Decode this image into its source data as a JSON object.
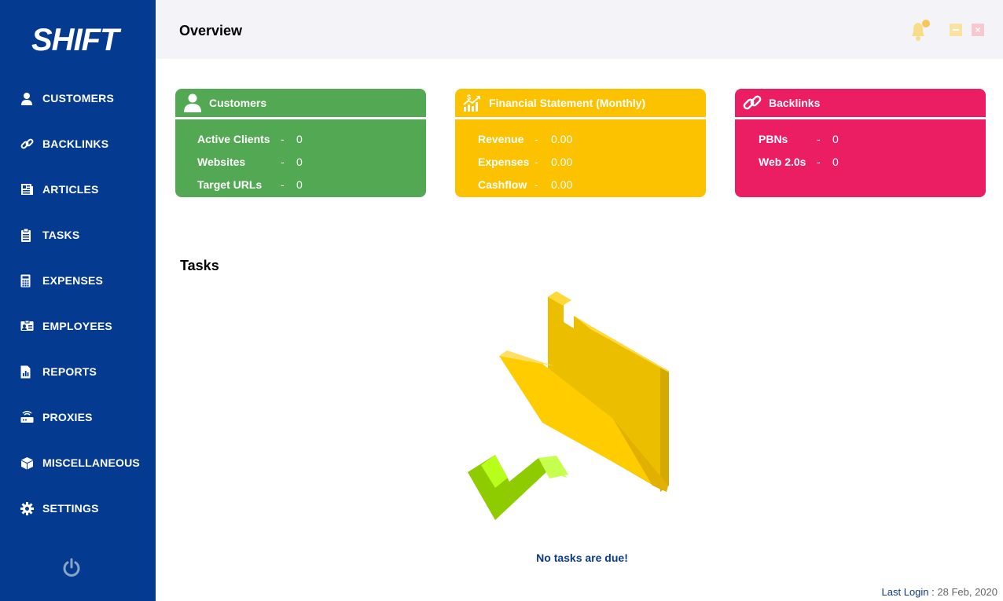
{
  "app": {
    "logo_text": "SHIFT",
    "colors": {
      "sidebar": "#043a8f",
      "header": "#f4f4f8",
      "green": "#53a953",
      "yellow": "#fcc200",
      "pink": "#eb1e63",
      "accent_text": "#0a3a8a"
    }
  },
  "sidebar": {
    "items": [
      {
        "label": "CUSTOMERS",
        "icon": "user-icon"
      },
      {
        "label": "BACKLINKS",
        "icon": "link-icon"
      },
      {
        "label": "ARTICLES",
        "icon": "newspaper-icon"
      },
      {
        "label": "TASKS",
        "icon": "clipboard-icon"
      },
      {
        "label": "EXPENSES",
        "icon": "calculator-icon"
      },
      {
        "label": "EMPLOYEES",
        "icon": "id-card-icon"
      },
      {
        "label": "REPORTS",
        "icon": "report-icon"
      },
      {
        "label": "PROXIES",
        "icon": "router-icon"
      },
      {
        "label": "MISCELLANEOUS",
        "icon": "box-icon"
      },
      {
        "label": "SETTINGS",
        "icon": "gear-icon"
      }
    ],
    "power_icon": "power-icon"
  },
  "header": {
    "title": "Overview",
    "bell_icon": "bell-icon",
    "minimize_icon": "minimize-icon",
    "close_icon": "close-icon"
  },
  "cards": {
    "customers": {
      "title": "Customers",
      "icon": "user-icon",
      "rows": [
        {
          "label": "Active Clients",
          "dash": "-",
          "value": "0"
        },
        {
          "label": "Websites",
          "dash": "-",
          "value": "0"
        },
        {
          "label": "Target URLs",
          "dash": "-",
          "value": "0"
        }
      ]
    },
    "financial": {
      "title": "Financial Statement (Monthly)",
      "icon": "chart-growth-icon",
      "rows": [
        {
          "label": "Revenue",
          "dash": "-",
          "value": "0.00"
        },
        {
          "label": "Expenses",
          "dash": "-",
          "value": "0.00"
        },
        {
          "label": "Cashflow",
          "dash": "-",
          "value": "0.00"
        }
      ]
    },
    "backlinks": {
      "title": "Backlinks",
      "icon": "link-icon",
      "rows": [
        {
          "label": "PBNs",
          "dash": "-",
          "value": "0"
        },
        {
          "label": "Web 2.0s",
          "dash": "-",
          "value": "0"
        }
      ]
    }
  },
  "tasks": {
    "title": "Tasks",
    "illustration": "folder-check-illustration",
    "empty_message": "No tasks are due!"
  },
  "footer": {
    "last_login_label": "Last Login :",
    "last_login_date": "28 Feb, 2020"
  }
}
